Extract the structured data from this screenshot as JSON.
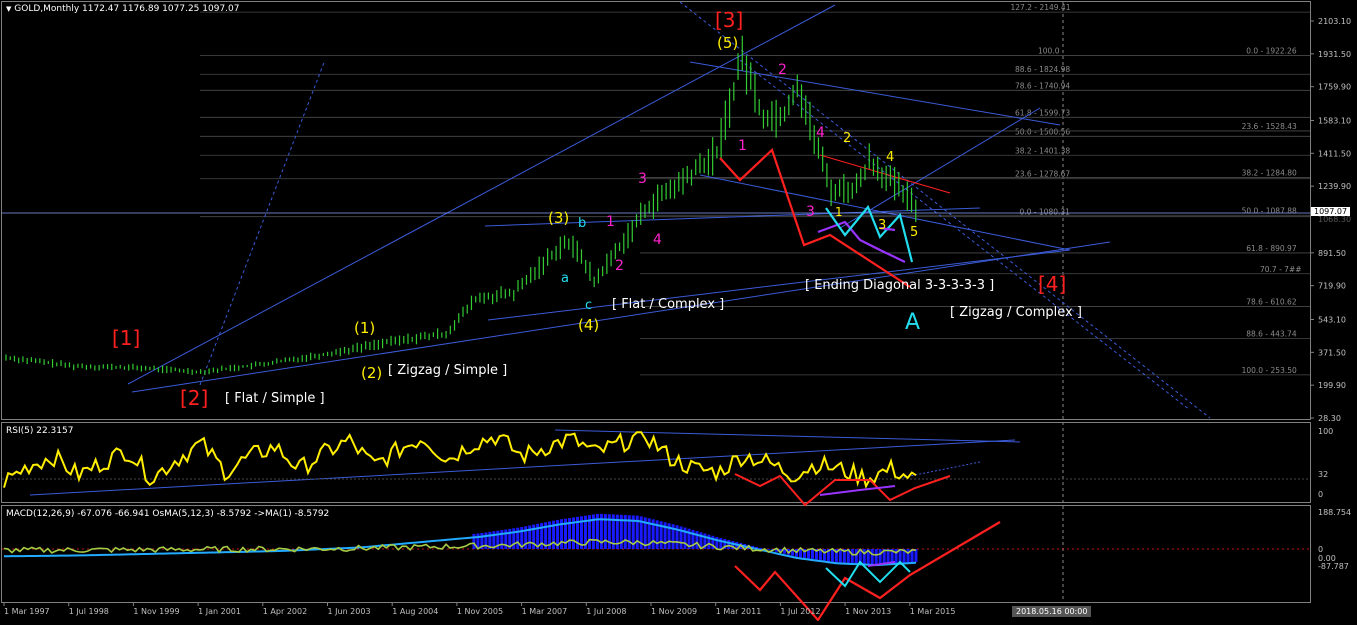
{
  "colors": {
    "background": "#000000",
    "frame": "#808080",
    "grid": "#4a4a4a",
    "price": "#33cc33",
    "trendline": "#3b5bd9",
    "fib": "#8a8a8a",
    "wave_red": "#ff2020",
    "wave_yellow": "#ffee00",
    "wave_magenta": "#ff22cc",
    "wave_cyan": "#22ddee",
    "wave_purple": "#9933ff",
    "rsi": "#ffee00",
    "macd_hist": "#1a1aff",
    "macd_line": "#a6cc44",
    "osma_line": "#22aaff",
    "label_white": "#ffffff",
    "axis_text": "#c0c0c0"
  },
  "header": {
    "symbol_info": "GOLD,Monthly  1172.47 1176.89 1077.25 1097.07",
    "chevron_glyph": "▼"
  },
  "rsi_header": "RSI(5) 22.3157",
  "macd_header": "MACD(12,26,9) -67.076 -66.941  OsMA(5,12,3) -8.5792  ->MA(1) -8.5792",
  "time_badge": "2018.05.16 00:00",
  "price_axis": {
    "ticks": [
      {
        "label": "2103.10",
        "value": 2103.1
      },
      {
        "label": "1931.50",
        "value": 1931.5
      },
      {
        "label": "1759.90",
        "value": 1759.9
      },
      {
        "label": "1583.10",
        "value": 1583.1
      },
      {
        "label": "1411.50",
        "value": 1411.5
      },
      {
        "label": "1239.90",
        "value": 1239.9
      },
      {
        "label": "891.50",
        "value": 891.5
      },
      {
        "label": "719.90",
        "value": 719.9
      },
      {
        "label": "543.10",
        "value": 543.1
      },
      {
        "label": "371.50",
        "value": 371.5
      },
      {
        "label": "199.90",
        "value": 199.9
      },
      {
        "label": "28.30",
        "value": 28.3
      }
    ],
    "hidden_tick": {
      "label": "1068.30",
      "value": 1068.3
    },
    "current_price": {
      "label": "1097.07",
      "value": 1097.07
    }
  },
  "rsi_axis": {
    "ticks": [
      {
        "label": "100",
        "value": 100
      },
      {
        "label": "32",
        "value": 32
      },
      {
        "label": "0",
        "value": 0
      }
    ]
  },
  "macd_axis": {
    "ticks": [
      {
        "label": "188.754",
        "value": 188.754
      },
      {
        "label": "0",
        "value": 0
      },
      {
        "label": "0.00",
        "value": -45
      },
      {
        "label": "-87.787",
        "value": -87.787
      }
    ]
  },
  "time_axis": [
    "1 Mar 1997",
    "1 Jul 1998",
    "1 Nov 1999",
    "1 Jan 2001",
    "1 Apr 2002",
    "1 Jun 2003",
    "1 Aug 2004",
    "1 Nov 2005",
    "1 Mar 2007",
    "1 Jul 2008",
    "1 Nov 2009",
    "1 Mar 2011",
    "1 Jul 2012",
    "1 Nov 2013",
    "1 Mar 2015"
  ],
  "fib_levels": [
    {
      "label": "127.2 - 2149.41",
      "value": 2149.41
    },
    {
      "label": "100.0",
      "value": 1922.26
    },
    {
      "label": "0.0 - 1922.26",
      "value": 1922.26
    },
    {
      "label": "88.6 - 1824.98",
      "value": 1824.98
    },
    {
      "label": "78.6 - 1740.94",
      "value": 1740.94
    },
    {
      "label": "61.8 - 1599.73",
      "value": 1599.73
    },
    {
      "label": "50.0 - 1500.56",
      "value": 1500.56
    },
    {
      "label": "23.6 - 1528.43",
      "value": 1528.43
    },
    {
      "label": "38.2 - 1401.38",
      "value": 1401.38
    },
    {
      "label": "38.2 - 1284.80",
      "value": 1284.8
    },
    {
      "label": "23.6 - 1278.67",
      "value": 1278.67
    },
    {
      "label": "0.0 - 1080.31",
      "value": 1080.31
    },
    {
      "label": "50.0 - 1087.88",
      "value": 1087.88
    },
    {
      "label": "61.8 - 890.97",
      "value": 890.97
    },
    {
      "label": "70.7 - 7##",
      "value": 782
    },
    {
      "label": "78.6 - 610.62",
      "value": 610.62
    },
    {
      "label": "88.6 - 443.74",
      "value": 443.74
    },
    {
      "label": "100.0 - 253.50",
      "value": 253.5
    }
  ],
  "wave_labels": {
    "w1_big": "[1]",
    "w2_big": "[2]",
    "w3_big": "[3]",
    "w4_big": "[4]",
    "w1": "(1)",
    "w2": "(2)",
    "w3": "(3)",
    "w4": "(4)",
    "w5": "(5)",
    "a": "a",
    "b": "b",
    "c": "c",
    "m1a": "1",
    "m2a": "2",
    "m3a": "3",
    "m4a": "4",
    "m1b": "1",
    "m2b": "2",
    "m3b": "3",
    "m4b": "4",
    "y2": "2",
    "y4": "4",
    "y5": "5",
    "y3": "3",
    "c1": "1",
    "bigA": "A"
  },
  "annotations": {
    "flat_simple": "[ Flat / Simple ]",
    "zigzag_simple": "[ Zigzag / Simple ]",
    "flat_complex": "[ Flat / Complex ]",
    "ending_diagonal": "[ Ending Diagonal 3-3-3-3-3 ]",
    "zigzag_complex": "[ Zigzag / Complex ]"
  },
  "chart_data": [
    {
      "type": "line",
      "title": "GOLD,Monthly",
      "x_range": [
        "1997-03",
        "2018-05"
      ],
      "ylim": [
        28.3,
        2190
      ],
      "series": [
        {
          "values_x": [
            "1997-03",
            "1998-07",
            "1999-11",
            "2001-01",
            "2002-04",
            "2003-06",
            "2004-08",
            "2005-11",
            "2006-06",
            "2007-03",
            "2008-03",
            "2008-07",
            "2008-10",
            "2009-11",
            "2010-06",
            "2011-03",
            "2011-09",
            "2012-02",
            "2012-07",
            "2012-10",
            "2013-06",
            "2013-12",
            "2014-03",
            "2014-12",
            "2015-03"
          ],
          "values": [
            345,
            300,
            290,
            270,
            310,
            360,
            420,
            470,
            650,
            680,
            950,
            880,
            740,
            1140,
            1250,
            1410,
            1920,
            1600,
            1620,
            1780,
            1220,
            1230,
            1380,
            1180,
            1097
          ]
        }
      ]
    },
    {
      "type": "line",
      "title": "RSI(5) 22.3157",
      "ylim": [
        0,
        100
      ],
      "series": [
        {
          "values": [
            20,
            45,
            60,
            30,
            50,
            70,
            25,
            55,
            80,
            35,
            60,
            75,
            40,
            65,
            85,
            45,
            70,
            90,
            55,
            80,
            92,
            60,
            75,
            88,
            65,
            80,
            95,
            58,
            40,
            35,
            62,
            50,
            30,
            48,
            38,
            25,
            40,
            22
          ]
        }
      ]
    },
    {
      "type": "bar",
      "title": "MACD(12,26,9) -67.076 -66.941 OsMA(5,12,3) -8.5792 ->MA(1) -8.5792",
      "ylim": [
        -87.787,
        188.754
      ],
      "series": [
        {
          "name": "MACD",
          "values": [
            -30,
            -28,
            -25,
            -20,
            -15,
            -10,
            -5,
            0,
            10,
            20,
            40,
            60,
            80,
            110,
            150,
            180,
            170,
            120,
            60,
            10,
            -40,
            -70,
            -80,
            -67
          ]
        }
      ]
    }
  ]
}
